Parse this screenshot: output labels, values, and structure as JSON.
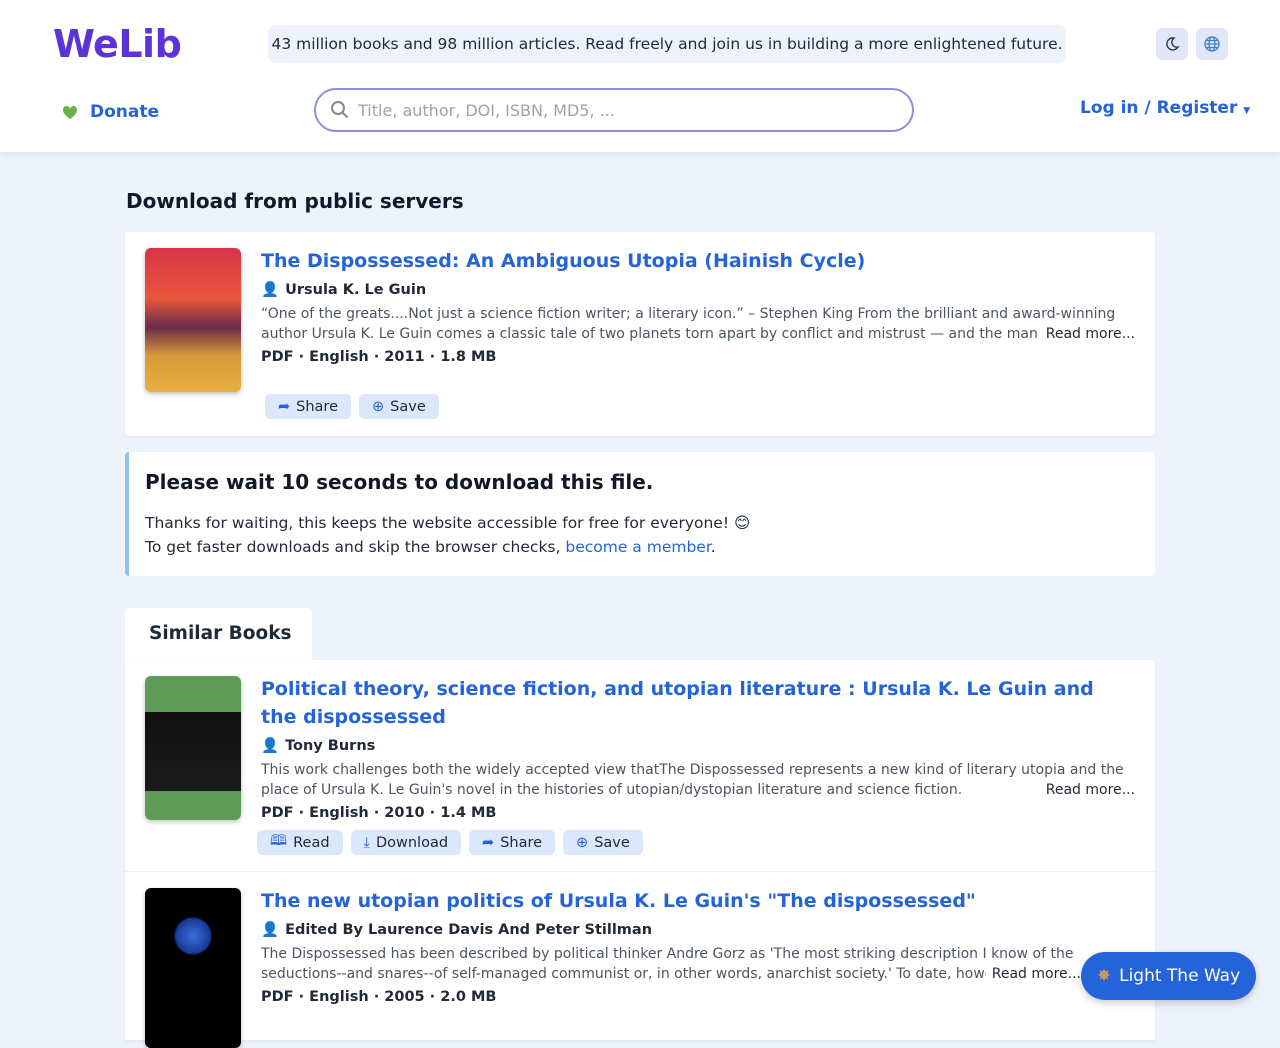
{
  "header": {
    "logo": "WeLib",
    "banner": "43 million books and 98 million articles. Read freely and join us in building a more enlightened future.",
    "donate": "Donate",
    "search_placeholder": "Title, author, DOI, ISBN, MD5, ...",
    "login": "Log in / Register"
  },
  "main": {
    "heading": "Download from public servers",
    "book": {
      "title": "The Dispossessed: An Ambiguous Utopia (Hainish Cycle)",
      "author": "Ursula K. Le Guin",
      "description": "“One of the greats....Not just a science fiction writer; a literary icon.” – Stephen King From the brilliant and award-winning author Ursula K. Le Guin comes a classic tale of two planets torn apart by conflict and mistrust — and the man who",
      "read_more": "Read more...",
      "meta": "PDF · English · 2011 · 1.8 MB",
      "share": "Share",
      "save": "Save"
    },
    "wait": {
      "title": "Please wait 10 seconds to download this file.",
      "line1": "Thanks for waiting, this keeps the website accessible for free for everyone! 😊",
      "line2_prefix": "To get faster downloads and skip the browser checks, ",
      "line2_link": "become a member",
      "line2_suffix": "."
    }
  },
  "similar": {
    "tab": "Similar Books",
    "books": [
      {
        "title": "Political theory, science fiction, and utopian literature : Ursula K. Le Guin and the dispossessed",
        "author": "Tony Burns",
        "description": "This work challenges both the widely accepted view thatThe Dispossessed represents a new kind of literary utopia and the place of Ursula K. Le Guin's novel in the histories of utopian/dystopian literature and science fiction.",
        "read_more": "Read more...",
        "meta": "PDF · English · 2010 · 1.4 MB",
        "read": "Read",
        "download": "Download",
        "share": "Share",
        "save": "Save"
      },
      {
        "title": "The new utopian politics of Ursula K. Le Guin's \"The dispossessed\"",
        "author": "Edited By Laurence Davis And Peter Stillman",
        "description": "The Dispossessed has been described by political thinker Andre Gorz as 'The most striking description I know of the seductions--and snares--of self-managed communist or, in other words, anarchist society.' To date, however, the",
        "read_more": "Read more...",
        "meta": "PDF · English · 2005 · 2.0 MB"
      }
    ]
  },
  "floating": {
    "label": "Light The Way"
  }
}
